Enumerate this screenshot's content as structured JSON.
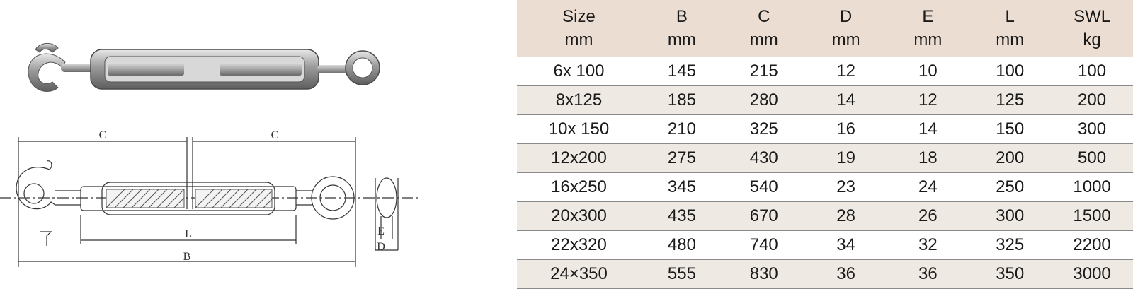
{
  "diagram": {
    "labels": {
      "c_left": "C",
      "c_right": "C",
      "l": "L",
      "b": "B",
      "e": "E",
      "d": "D"
    }
  },
  "table": {
    "headers": [
      {
        "top": "Size",
        "unit": "mm"
      },
      {
        "top": "B",
        "unit": "mm"
      },
      {
        "top": "C",
        "unit": "mm"
      },
      {
        "top": "D",
        "unit": "mm"
      },
      {
        "top": "E",
        "unit": "mm"
      },
      {
        "top": "L",
        "unit": "mm"
      },
      {
        "top": "SWL",
        "unit": "kg"
      }
    ],
    "rows": [
      [
        "6x 100",
        "145",
        "215",
        "12",
        "10",
        "100",
        "100"
      ],
      [
        "8x125",
        "185",
        "280",
        "14",
        "12",
        "125",
        "200"
      ],
      [
        "10x 150",
        "210",
        "325",
        "16",
        "14",
        "150",
        "300"
      ],
      [
        "12x200",
        "275",
        "430",
        "19",
        "18",
        "200",
        "500"
      ],
      [
        "16x250",
        "345",
        "540",
        "23",
        "24",
        "250",
        "1000"
      ],
      [
        "20x300",
        "435",
        "670",
        "28",
        "26",
        "300",
        "1500"
      ],
      [
        "22x320",
        "480",
        "740",
        "34",
        "32",
        "325",
        "2200"
      ],
      [
        "24×350",
        "555",
        "830",
        "36",
        "36",
        "350",
        "3000"
      ]
    ]
  },
  "colors": {
    "header_bg": "#ecddd3",
    "alt_row_bg": "#eee9e2",
    "rule": "#8a8a8a"
  }
}
